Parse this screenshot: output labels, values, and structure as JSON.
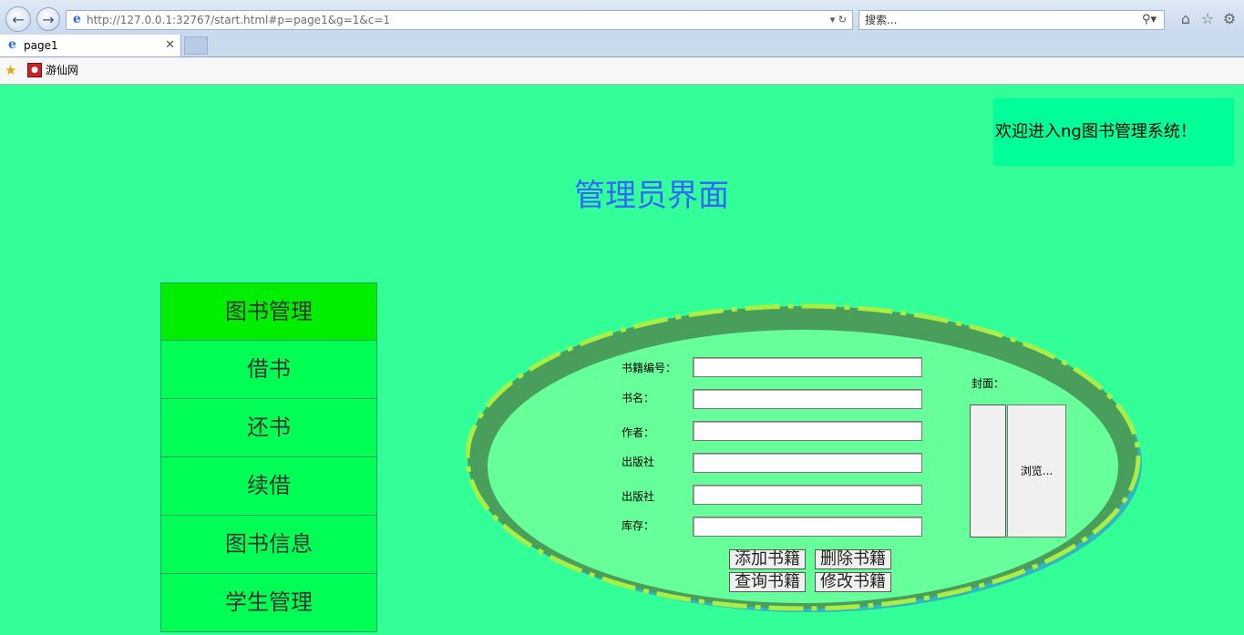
{
  "browser": {
    "url": "http://127.0.0.1:32767/start.html#p=page1&g=1&c=1",
    "search_placeholder": "搜索...",
    "tab_title": "page1",
    "favorites": [
      {
        "label": "游仙网"
      }
    ]
  },
  "header": {
    "welcome": "欢迎进入ng图书管理系统！",
    "title": "管理员界面"
  },
  "sidebar": {
    "items": [
      {
        "label": "图书管理",
        "active": true
      },
      {
        "label": "借书"
      },
      {
        "label": "还书"
      },
      {
        "label": "续借"
      },
      {
        "label": "图书信息"
      },
      {
        "label": "学生管理"
      }
    ]
  },
  "form": {
    "fields": [
      {
        "label": "书籍编号：",
        "value": ""
      },
      {
        "label": "书名：",
        "value": ""
      },
      {
        "label": "作者：",
        "value": ""
      },
      {
        "label": "出版社",
        "value": ""
      },
      {
        "label": "出版社",
        "value": ""
      },
      {
        "label": "库存：",
        "value": ""
      }
    ],
    "cover_label": "封面：",
    "browse_label": "浏览...",
    "buttons": {
      "add": "添加书籍",
      "delete": "删除书籍",
      "query": "查询书籍",
      "edit": "修改书籍"
    }
  },
  "colors": {
    "page_bg": "#33ff99",
    "welcome_bg": "#00ff99",
    "title": "#3366ff",
    "menu_active": "#00ee00",
    "menu_item": "#00ff55",
    "ellipse_fill": "#66ff99",
    "ellipse_ring": "#4a9e5c",
    "ellipse_dash": "#aaee44"
  }
}
